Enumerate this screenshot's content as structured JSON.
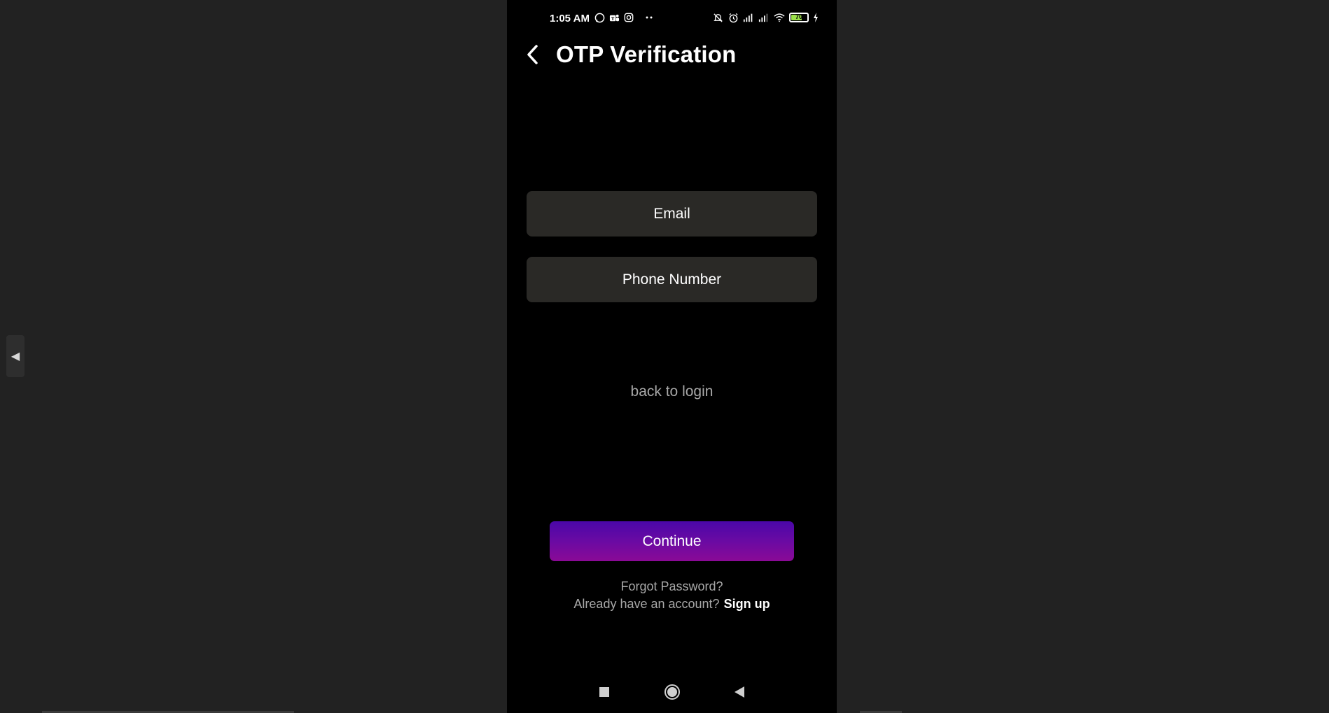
{
  "status_bar": {
    "time": "1:05 AM",
    "left_icons": [
      "whatsapp-icon",
      "teams-icon",
      "instagram-icon",
      "more-dots-icon"
    ],
    "right_icons": [
      "mute-icon",
      "alarm-icon",
      "signal-icon",
      "signal-icon",
      "wifi-icon",
      "battery-icon",
      "charging-icon"
    ],
    "battery_level": "70"
  },
  "app_bar": {
    "back_icon": "chevron-left-icon",
    "title": "OTP Verification"
  },
  "form": {
    "email_placeholder": "Email",
    "phone_placeholder": "Phone Number",
    "back_to_login": "back to login",
    "continue_label": "Continue",
    "forgot_password": "Forgot Password?",
    "account_prompt": "Already have an account?",
    "sign_up": "Sign up"
  },
  "colors": {
    "background": "#000000",
    "field_background": "#2a2926",
    "button_gradient_top": "#4a07a8",
    "button_gradient_bottom": "#8a0a96",
    "muted_text": "#a8a8a8"
  },
  "nav_bar": {
    "icons": [
      "recents-square-icon",
      "home-circle-icon",
      "back-triangle-icon"
    ]
  }
}
